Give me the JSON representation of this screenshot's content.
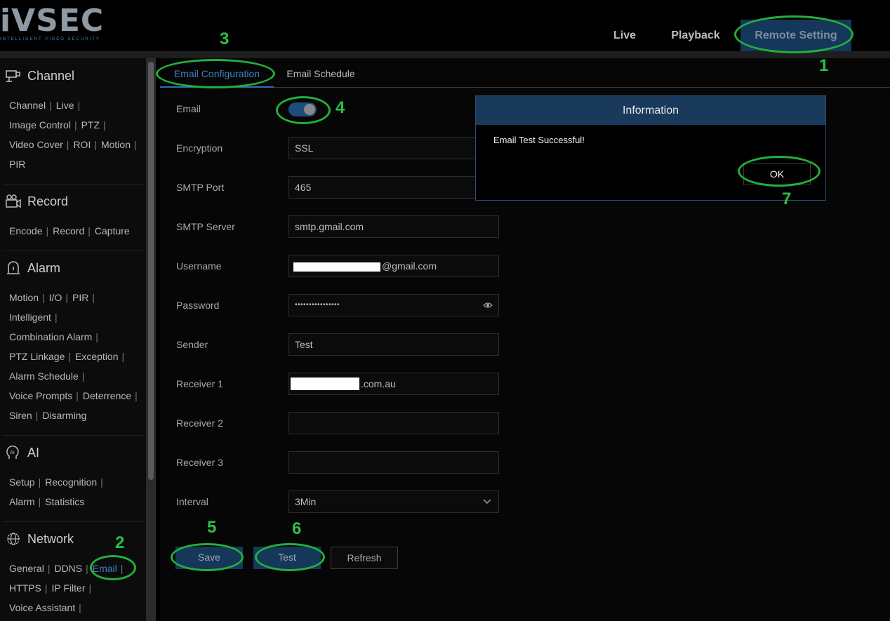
{
  "brand": {
    "name": "iVSEC",
    "tagline": "INTELLIGENT VIDEO SECURITY"
  },
  "nav": {
    "live": "Live",
    "playback": "Playback",
    "remote_setting": "Remote Setting"
  },
  "sidebar": {
    "channel": {
      "title": "Channel",
      "rows": [
        [
          "Channel",
          "Live"
        ],
        [
          "Image Control",
          "PTZ"
        ],
        [
          "Video Cover",
          "ROI",
          "Motion"
        ],
        [
          "PIR"
        ]
      ]
    },
    "record": {
      "title": "Record",
      "rows": [
        [
          "Encode",
          "Record",
          "Capture"
        ]
      ]
    },
    "alarm": {
      "title": "Alarm",
      "rows": [
        [
          "Motion",
          "I/O",
          "PIR"
        ],
        [
          "Intelligent"
        ],
        [
          "Combination Alarm"
        ],
        [
          "PTZ Linkage",
          "Exception"
        ],
        [
          "Alarm Schedule"
        ],
        [
          "Voice Prompts",
          "Deterrence"
        ],
        [
          "Siren",
          "Disarming"
        ]
      ]
    },
    "ai": {
      "title": "AI",
      "icon_text": "AI",
      "rows": [
        [
          "Setup",
          "Recognition"
        ],
        [
          "Alarm",
          "Statistics"
        ]
      ]
    },
    "network": {
      "title": "Network",
      "rows": [
        [
          "General",
          "DDNS",
          "Email"
        ],
        [
          "HTTPS",
          "IP Filter"
        ],
        [
          "Voice Assistant"
        ]
      ]
    }
  },
  "tabs": {
    "email_configuration": "Email Configuration",
    "email_schedule": "Email Schedule"
  },
  "form": {
    "email_label": "Email",
    "email_enabled": true,
    "encryption_label": "Encryption",
    "encryption_value": "SSL",
    "smtp_port_label": "SMTP Port",
    "smtp_port_value": "465",
    "smtp_server_label": "SMTP Server",
    "smtp_server_value": "smtp.gmail.com",
    "username_label": "Username",
    "username_value": "@gmail.com",
    "password_label": "Password",
    "password_value": "••••••••••••••••",
    "sender_label": "Sender",
    "sender_value": "Test",
    "receiver1_label": "Receiver 1",
    "receiver1_value": ".com.au",
    "receiver2_label": "Receiver 2",
    "receiver2_value": "",
    "receiver3_label": "Receiver 3",
    "receiver3_value": "",
    "interval_label": "Interval",
    "interval_value": "3Min"
  },
  "buttons": {
    "save": "Save",
    "test": "Test",
    "refresh": "Refresh"
  },
  "dialog": {
    "title": "Information",
    "message": "Email Test Successful!",
    "ok": "OK"
  },
  "annotations": [
    "1",
    "2",
    "3",
    "4",
    "5",
    "6",
    "7"
  ],
  "colors": {
    "accent": "#3d7fc0",
    "highlight": "#14375a",
    "annotation": "#22b03a"
  }
}
